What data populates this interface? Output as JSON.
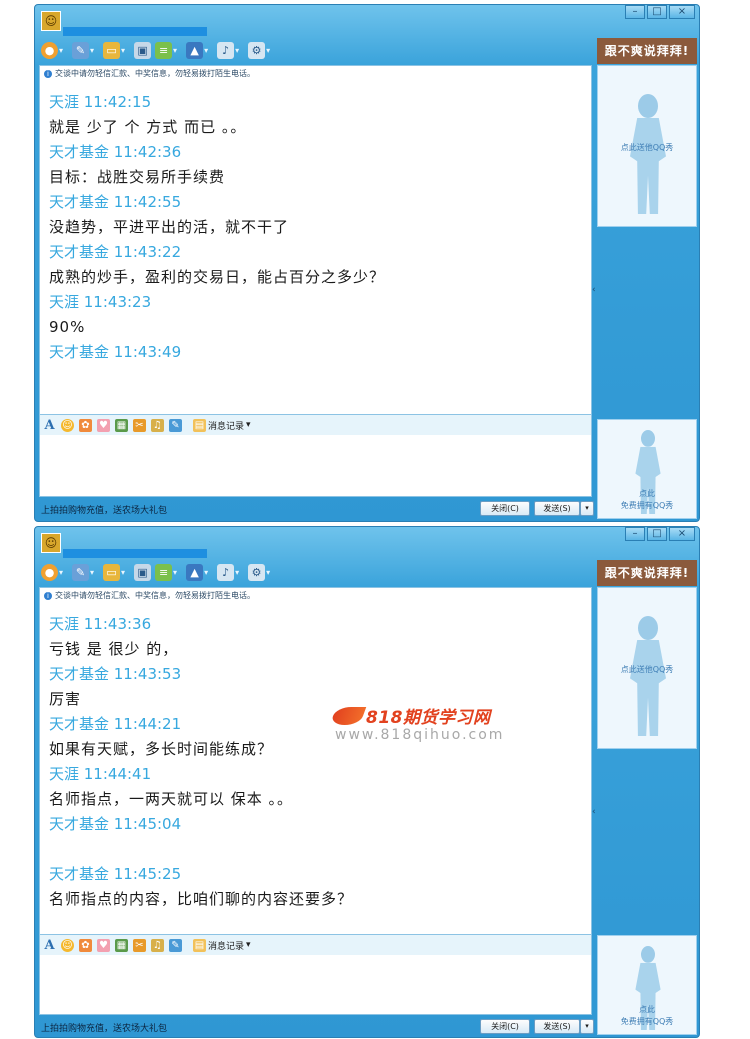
{
  "windows": [
    {
      "notice": "交谈中请勿轻信汇款、中奖信息，勿轻易拨打陌生电话。",
      "ad_banner": "跟不爽说拜拜!",
      "sidebar_top_label": "点此送他QQ秀",
      "sidebar_bottom_label_1": "点此",
      "sidebar_bottom_label_2": "免费拥有QQ秀",
      "history_label": "消息记录",
      "promo": "上拍拍购物充值，送农场大礼包",
      "close_btn": "关闭(C)",
      "send_btn": "发送(S)",
      "messages": [
        {
          "sender": "天涯 11:42:15",
          "text": "就是 少了 个  方式  而已  。。"
        },
        {
          "sender": "天才基金 11:42:36",
          "text": "目标：战胜交易所手续费"
        },
        {
          "sender": "天才基金 11:42:55",
          "text": "没趋势，平进平出的活，就不干了"
        },
        {
          "sender": "天才基金 11:43:22",
          "text": "成熟的炒手，盈利的交易日，能占百分之多少？"
        },
        {
          "sender": "天涯 11:43:23",
          "text": "90%"
        },
        {
          "sender": "天才基金 11:43:49",
          "text": ""
        }
      ]
    },
    {
      "notice": "交谈中请勿轻信汇款、中奖信息，勿轻易拨打陌生电话。",
      "ad_banner": "跟不爽说拜拜!",
      "sidebar_top_label": "点此送他QQ秀",
      "sidebar_bottom_label_1": "点此",
      "sidebar_bottom_label_2": "免费拥有QQ秀",
      "history_label": "消息记录",
      "promo": "上拍拍购物充值，送农场大礼包",
      "close_btn": "关闭(C)",
      "send_btn": "发送(S)",
      "messages": [
        {
          "sender": "天涯 11:43:36",
          "text": "亏钱 是  很少 的，"
        },
        {
          "sender": "天才基金 11:43:53",
          "text": "厉害"
        },
        {
          "sender": "天才基金 11:44:21",
          "text": "如果有天赋，多长时间能练成？"
        },
        {
          "sender": "天涯 11:44:41",
          "text": "名师指点，一两天就可以  保本 。。"
        },
        {
          "sender": "天才基金 11:45:04",
          "text": ""
        },
        {
          "sender": "天才基金 11:45:25",
          "text": "名师指点的内容，比咱们聊的内容还要多？"
        }
      ]
    }
  ],
  "watermark": {
    "title": "818期货学习网",
    "url": "www.818qihuo.com"
  }
}
